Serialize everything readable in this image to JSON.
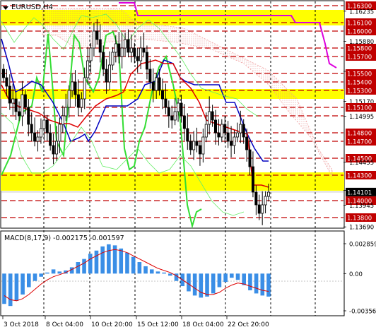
{
  "window": {
    "symbol_label": "EURUSD,H4"
  },
  "chart_data": [
    {
      "type": "candlestick",
      "title": "EURUSD,H4",
      "price_axis_labels": [
        "1.16300",
        "1.16235",
        "1.16100",
        "1.16000",
        "1.15880",
        "1.15800",
        "1.15700",
        "1.15525",
        "1.15500",
        "1.15400",
        "1.15300",
        "1.15170",
        "1.15100",
        "1.14995",
        "1.14800",
        "1.14700",
        "1.14500",
        "1.14455",
        "1.14300",
        "1.14120",
        "1.14101",
        "1.14000",
        "1.13945",
        "1.13800",
        "1.13690"
      ],
      "current_price": "1.14101",
      "support_resistance_levels": [
        1.163,
        1.161,
        1.16,
        1.158,
        1.157,
        1.155,
        1.154,
        1.153,
        1.151,
        1.15,
        1.148,
        1.147,
        1.145,
        1.143,
        1.14,
        1.138
      ],
      "highlighted_zones": [
        [
          1.161,
          1.163
        ],
        [
          1.153,
          1.154
        ],
        [
          1.143,
          1.145
        ]
      ],
      "time_labels": [
        "3 Oct 2018",
        "8 Oct 04:00",
        "10 Oct 20:00",
        "15 Oct 12:00",
        "18 Oct 04:00",
        "22 Oct 20:00"
      ],
      "colors": {
        "up_candle": "#000000",
        "down_candle": "#000000",
        "levels": "#c00000",
        "zones": "#ffff00",
        "ma_blue": "#0000c0",
        "ma_red": "#dd0000",
        "ma_green": "#33dd33",
        "ma_magenta": "#dd00dd"
      }
    },
    {
      "type": "histogram",
      "title": "MACD(8,17,9)",
      "label": "MACD(8,17,9)",
      "values_label": "-0.002175 -0.001597",
      "axis_labels": [
        "0.002859",
        "0.00",
        "-0.003561"
      ],
      "ylim": [
        -0.003561,
        0.002859
      ],
      "histogram": [
        -0.0029,
        -0.0031,
        -0.0026,
        -0.002,
        -0.0013,
        -0.0007,
        -0.0003,
        0.0001,
        0.0004,
        0.0002,
        0.0003,
        0.0006,
        0.0011,
        0.0014,
        0.0019,
        0.0022,
        0.0026,
        0.0028,
        0.0027,
        0.0024,
        0.002,
        0.0016,
        0.0011,
        0.0007,
        0.0004,
        0.0002,
        0.0001,
        -0.0002,
        -0.0007,
        -0.0012,
        -0.0017,
        -0.0021,
        -0.0023,
        -0.0022,
        -0.0019,
        -0.0013,
        -0.0008,
        -0.0004,
        -0.0006,
        -0.0011,
        -0.0016,
        -0.0019,
        -0.0021,
        -0.0022
      ],
      "signal_line": [
        -0.0021,
        -0.0025,
        -0.0026,
        -0.0024,
        -0.002,
        -0.0015,
        -0.001,
        -0.0006,
        -0.0003,
        -0.0001,
        0.0001,
        0.0004,
        0.0007,
        0.001,
        0.0014,
        0.0017,
        0.002,
        0.0022,
        0.0023,
        0.0022,
        0.002,
        0.0017,
        0.0014,
        0.0011,
        0.0008,
        0.0005,
        0.0003,
        0.0001,
        -0.0002,
        -0.0006,
        -0.001,
        -0.0014,
        -0.0018,
        -0.002,
        -0.002,
        -0.0018,
        -0.0014,
        -0.0011,
        -0.0009,
        -0.001,
        -0.0012,
        -0.0014,
        -0.0016,
        -0.0017
      ]
    }
  ]
}
